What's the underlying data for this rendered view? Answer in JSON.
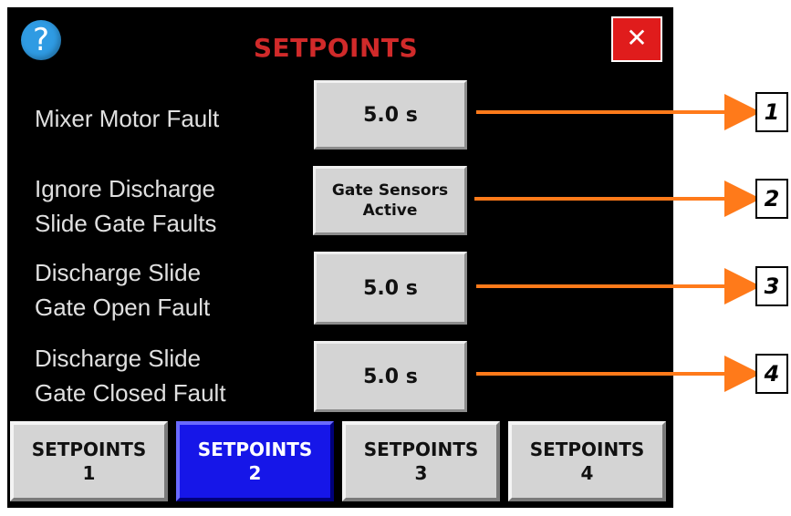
{
  "header": {
    "title": "SETPOINTS",
    "help_icon": "question-icon",
    "close_label": "✕"
  },
  "rows": [
    {
      "label": "Mixer Motor Fault",
      "value": "5.0 s"
    },
    {
      "label": "Ignore Discharge Slide Gate Faults",
      "label_line1": "Ignore Discharge",
      "label_line2": "Slide Gate Faults",
      "value_line1": "Gate Sensors",
      "value_line2": "Active"
    },
    {
      "label_line1": "Discharge Slide",
      "label_line2": "Gate Open Fault",
      "value": "5.0 s"
    },
    {
      "label_line1": "Discharge Slide",
      "label_line2": "Gate Closed Fault",
      "value": "5.0 s"
    }
  ],
  "tabs": [
    {
      "line1": "SETPOINTS",
      "line2": "1",
      "active": false
    },
    {
      "line1": "SETPOINTS",
      "line2": "2",
      "active": true
    },
    {
      "line1": "SETPOINTS",
      "line2": "3",
      "active": false
    },
    {
      "line1": "SETPOINTS",
      "line2": "4",
      "active": false
    }
  ],
  "callouts": [
    "1",
    "2",
    "3",
    "4"
  ],
  "colors": {
    "screen_bg": "#000000",
    "title": "#d02a2a",
    "close_bg": "#e01c1c",
    "help_bg": "#2f9be3",
    "button_bg": "#d4d4d4",
    "active_tab": "#1616e8",
    "arrow": "#ff7a1a"
  }
}
